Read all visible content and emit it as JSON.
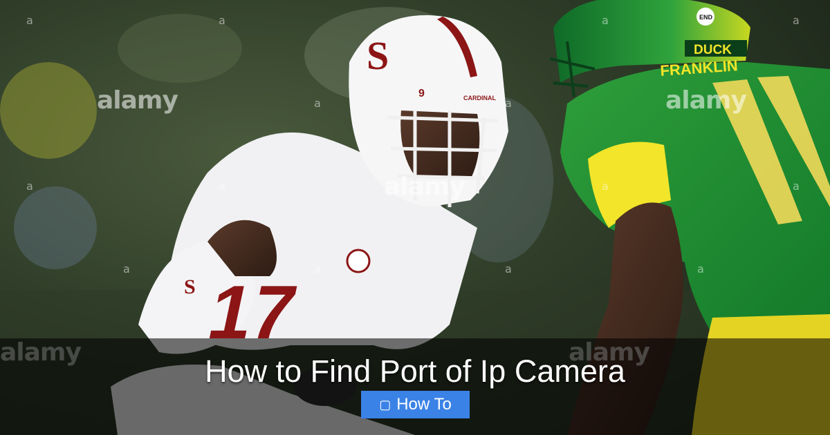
{
  "hero": {
    "title": "How to Find Port of Ip Camera",
    "category_label": "How To",
    "category_icon": "tag-icon",
    "accent_color": "#3b82e6"
  },
  "photo": {
    "watermark": "alamy",
    "watermark_small": "a",
    "helmet_logo": "S",
    "helmet_number": "9",
    "helmet_text": "CARDINAL",
    "jersey_number_white": "17",
    "jersey_number_green": "11",
    "oregon_name": "FRANKLIN",
    "oregon_helmet_text": "DUCKS",
    "end_racism": "END RACISM"
  }
}
